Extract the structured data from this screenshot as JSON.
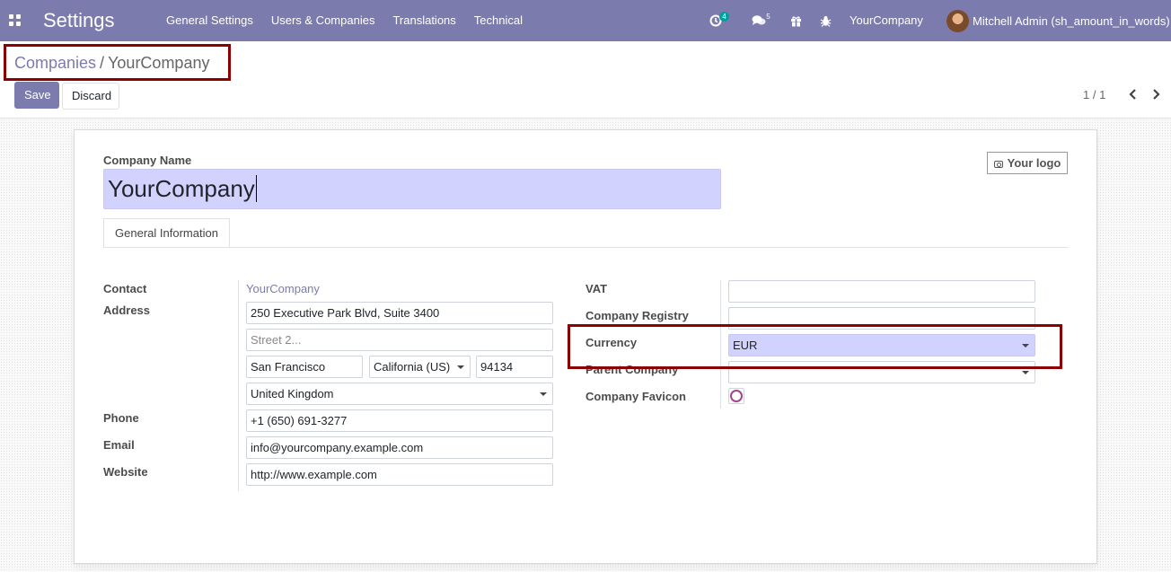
{
  "app": {
    "title": "Settings"
  },
  "menu": [
    "General Settings",
    "Users & Companies",
    "Translations",
    "Technical"
  ],
  "systray": {
    "activity_count": "4",
    "messages_count": "5",
    "company": "YourCompany",
    "user": "Mitchell Admin (sh_amount_in_words)"
  },
  "breadcrumb": {
    "parent": "Companies",
    "separator": "/",
    "current": "YourCompany"
  },
  "buttons": {
    "save": "Save",
    "discard": "Discard"
  },
  "pager": {
    "value": "1 / 1"
  },
  "form": {
    "company_name_label": "Company Name",
    "company_name": "YourCompany",
    "logo_button": "Your logo",
    "tab": "General Information",
    "left": {
      "contact_label": "Contact",
      "contact_value": "YourCompany",
      "address_label": "Address",
      "street": "250 Executive Park Blvd, Suite 3400",
      "street2_placeholder": "Street 2...",
      "city": "San Francisco",
      "state": "California (US)",
      "zip": "94134",
      "country": "United Kingdom",
      "phone_label": "Phone",
      "phone": "+1 (650) 691-3277",
      "email_label": "Email",
      "email": "info@yourcompany.example.com",
      "website_label": "Website",
      "website": "http://www.example.com"
    },
    "right": {
      "vat_label": "VAT",
      "vat": "",
      "registry_label": "Company Registry",
      "registry": "",
      "currency_label": "Currency",
      "currency": "EUR",
      "parent_label": "Parent Company",
      "parent": "",
      "favicon_label": "Company Favicon"
    }
  },
  "colors": {
    "primary": "#7c7bad",
    "highlight": "#8b0000",
    "input_focus": "#d2d2ff",
    "favicon_ring": "#a24689"
  }
}
